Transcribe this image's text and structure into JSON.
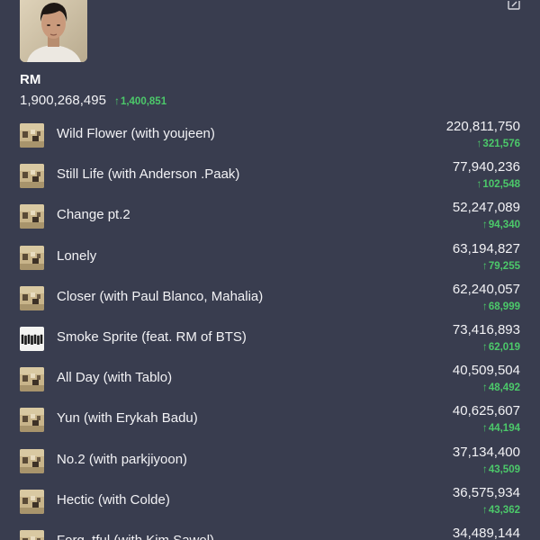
{
  "artist": {
    "name": "RM",
    "total_streams": "1,900,268,495",
    "daily_change": "1,400,851"
  },
  "colors": {
    "background": "#393d4f",
    "positive": "#4cc96a",
    "text": "#f2f2f5"
  },
  "icons": {
    "edit": "edit-icon",
    "increase": "arrow-up-icon"
  },
  "tracks": [
    {
      "title": "Wild Flower (with youjeen)",
      "streams": "220,811,750",
      "change": "321,576",
      "cover": "album"
    },
    {
      "title": "Still Life (with Anderson .Paak)",
      "streams": "77,940,236",
      "change": "102,548",
      "cover": "album"
    },
    {
      "title": "Change pt.2",
      "streams": "52,247,089",
      "change": "94,340",
      "cover": "album"
    },
    {
      "title": "Lonely",
      "streams": "63,194,827",
      "change": "79,255",
      "cover": "album"
    },
    {
      "title": "Closer (with Paul Blanco, Mahalia)",
      "streams": "62,240,057",
      "change": "68,999",
      "cover": "album"
    },
    {
      "title": "Smoke Sprite (feat. RM of BTS)",
      "streams": "73,416,893",
      "change": "62,019",
      "cover": "group"
    },
    {
      "title": "All Day (with Tablo)",
      "streams": "40,509,504",
      "change": "48,492",
      "cover": "album"
    },
    {
      "title": "Yun (with Erykah Badu)",
      "streams": "40,625,607",
      "change": "44,194",
      "cover": "album"
    },
    {
      "title": "No.2 (with parkjiyoon)",
      "streams": "37,134,400",
      "change": "43,509",
      "cover": "album"
    },
    {
      "title": "Hectic (with Colde)",
      "streams": "36,575,934",
      "change": "43,362",
      "cover": "album"
    },
    {
      "title": "Forg_tful (with Kim Sawol)",
      "streams": "34,489,144",
      "change": "",
      "cover": "album"
    }
  ]
}
